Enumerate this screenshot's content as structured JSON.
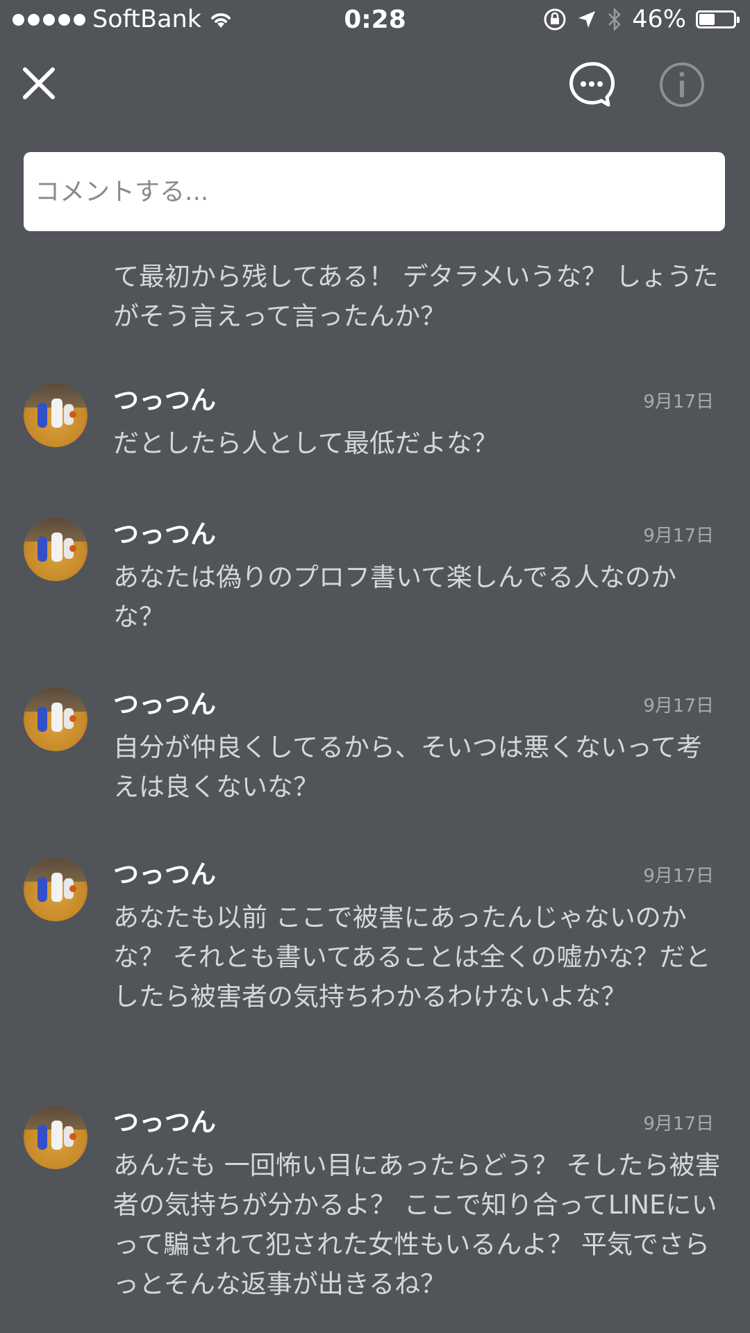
{
  "status_bar": {
    "carrier": "SoftBank",
    "time": "0:28",
    "battery_percent": "46%",
    "battery_level": 0.46
  },
  "nav": {
    "close_icon": "close-icon",
    "comment_icon": "chat-bubble-icon",
    "info_icon": "info-icon"
  },
  "comment_input": {
    "placeholder": "コメントする..."
  },
  "partial_comment": {
    "text": "て最初から残してある！ デタラメいうな？ しょうたがそう言えって言ったんか？"
  },
  "comments": [
    {
      "author": "つっつん",
      "date": "9月17日",
      "text": "だとしたら人として最低だよな？"
    },
    {
      "author": "つっつん",
      "date": "9月17日",
      "text": "あなたは偽りのプロフ書いて楽しんでる人なのかな？"
    },
    {
      "author": "つっつん",
      "date": "9月17日",
      "text": "自分が仲良くしてるから、そいつは悪くないって考えは良くないな？"
    },
    {
      "author": "つっつん",
      "date": "9月17日",
      "text": "あなたも以前 ここで被害にあったんじゃないのかな？ それとも書いてあることは全くの嘘かな？だとしたら被害者の気持ちわかるわけないよな？"
    },
    {
      "author": "つっつん",
      "date": "9月17日",
      "text": "あんたも 一回怖い目にあったらどう？ そしたら被害者の気持ちが分かるよ？ ここで知り合ってLINEにいって騙されて犯された女性もいるんよ？ 平気でさらっとそんな返事が出きるね？"
    }
  ],
  "colors": {
    "background": "#515458",
    "text": "#d6d7d9",
    "author": "#ffffff",
    "date": "#a9abae"
  }
}
